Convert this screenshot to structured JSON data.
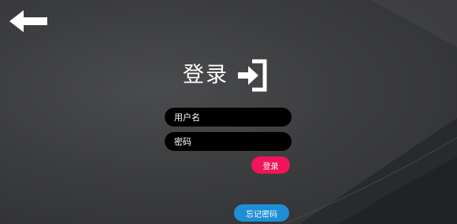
{
  "title": "登录",
  "icons": {
    "back": "arrow-left-icon",
    "login": "sign-in-icon"
  },
  "form": {
    "username_placeholder": "用户名",
    "password_placeholder": "密码",
    "login_label": "登录",
    "forgot_label": "忘记密码"
  },
  "colors": {
    "login_button": "#f0155b",
    "forgot_button": "#1e8fd6",
    "field_background": "#000000"
  }
}
